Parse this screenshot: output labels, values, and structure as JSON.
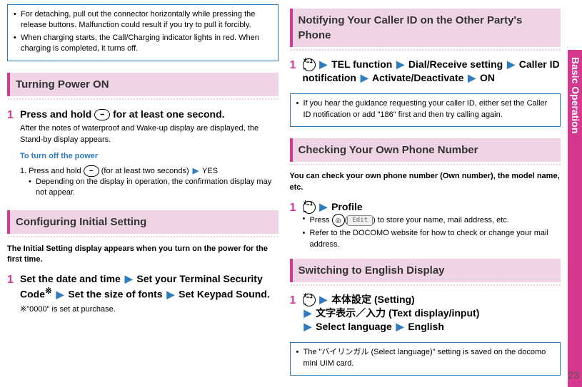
{
  "sideTab": {
    "label": "Basic Operation"
  },
  "pageNumber": "23",
  "left": {
    "topBullets": [
      "For detaching, pull out the connector horizontally while pressing the release buttons. Malfunction could result if you try to pull it forcibly.",
      "When charging starts, the Call/Charging indicator lights in red. When charging is completed, it turns off."
    ],
    "sec1": {
      "title": "Turning Power ON",
      "step1": {
        "pre": "Press and hold ",
        "keyGlyph": "⎯",
        "post": " for at least one second.",
        "desc": "After the notes of waterproof and Wake-up display are displayed, the Stand-by display appears.",
        "subTitle": "To turn off the power",
        "sub1_pre": "1. Press and hold ",
        "sub1_post": " (for at least two seconds)",
        "sub1_arrowText": "YES",
        "subBullet": "Depending on the display in operation, the confirmation display may not appear."
      }
    },
    "sec2": {
      "title": "Configuring Initial Setting",
      "intro": "The Initial Setting display appears when you turn on the power for the first time.",
      "step1": {
        "parts": [
          "Set the date and time",
          "Set your Terminal Security Code",
          "Set the size of fonts",
          "Set Keypad Sound."
        ],
        "sup": "※",
        "footnote": "※\"0000\" is set at purchase."
      }
    }
  },
  "right": {
    "sec1": {
      "title": "Notifying Your Caller ID on the Other Party's Phone",
      "step1": {
        "keyLabel": "ﾒﾆｭｰ",
        "parts": [
          "TEL function",
          "Dial/Receive setting",
          "Caller ID notification",
          "Activate/Deactivate",
          "ON"
        ]
      },
      "noteBullets": [
        "If you hear the guidance requesting your caller ID, either set the Caller ID notification or add \"186\" first and then try calling again."
      ]
    },
    "sec2": {
      "title": "Checking Your Own Phone Number",
      "intro": "You can check your own phone number (Own number), the model name, etc.",
      "step1": {
        "keyLabel": "ﾒﾆｭｰ",
        "label": "Profile",
        "b1_pre": "Press ",
        "b1_keyGlyph": "◎",
        "b1_pill": "Edit",
        "b1_post": " to store your name, mail address, etc.",
        "b2": "Refer to the DOCOMO website for how to check or change your mail address."
      }
    },
    "sec3": {
      "title": "Switching to English Display",
      "step1": {
        "keyLabel": "ﾒﾆｭｰ",
        "parts": [
          "本体設定 (Setting)",
          "文字表示／入力 (Text display/input)",
          "Select language",
          "English"
        ]
      },
      "noteBullets": [
        "The \"バイリンガル (Select language)\" setting is saved on the docomo mini UIM card."
      ]
    }
  }
}
